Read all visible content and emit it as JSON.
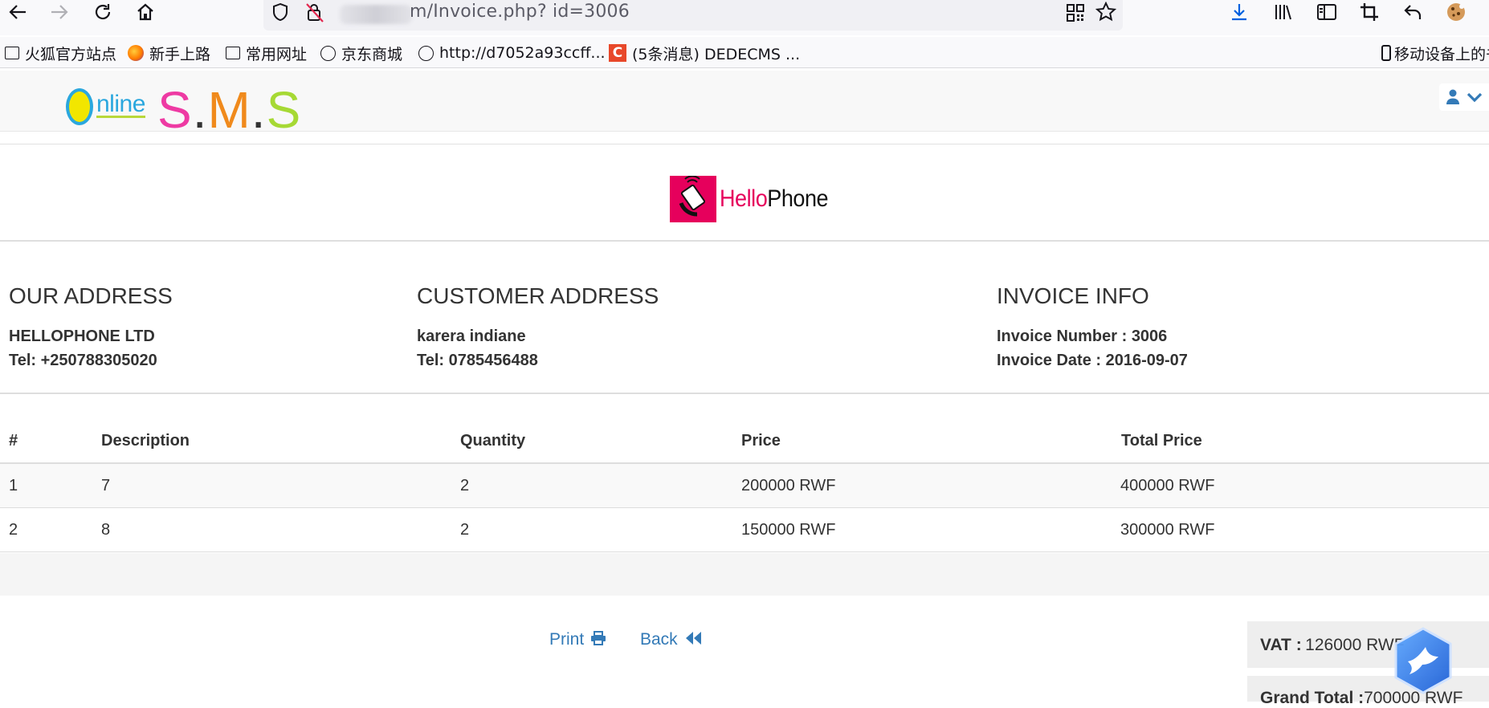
{
  "browser": {
    "url": "Invoice.php? id=3006",
    "url_prefix_visible": "m/Invoice.php? id=3006",
    "bookmarks": [
      {
        "label": "火狐官方站点",
        "icon": "folder-icon"
      },
      {
        "label": "新手上路",
        "icon": "firefox-icon"
      },
      {
        "label": "常用网址",
        "icon": "folder-icon"
      },
      {
        "label": "京东商城",
        "icon": "globe-icon"
      },
      {
        "label": "http://d7052a93ccff...",
        "icon": "globe-icon"
      },
      {
        "label": "(5条消息) DEDECMS ...",
        "icon": "csdn-icon"
      }
    ],
    "mobile_bookmarks": "移动设备上的书"
  },
  "app": {
    "logo_online_rest": "nline",
    "logo_sms": [
      "S",
      ".",
      "M",
      ".",
      "S"
    ]
  },
  "brand": {
    "hello": "Hello",
    "phone": "Phone"
  },
  "our_address": {
    "heading": "OUR ADDRESS",
    "name": "HELLOPHONE LTD",
    "tel": "Tel: +250788305020"
  },
  "customer_address": {
    "heading": "CUSTOMER ADDRESS",
    "name": "karera indiane",
    "tel": "Tel: 0785456488"
  },
  "invoice_info": {
    "heading": "INVOICE INFO",
    "number": "Invoice Number : 3006",
    "date": "Invoice Date : 2016-09-07"
  },
  "table": {
    "headers": [
      "#",
      "Description",
      "Quantity",
      "Price",
      "Total Price"
    ],
    "rows": [
      [
        "1",
        "7",
        "2",
        "200000 RWF",
        "400000 RWF"
      ],
      [
        "2",
        "8",
        "2",
        "150000 RWF",
        "300000 RWF"
      ]
    ]
  },
  "actions": {
    "print": "Print",
    "back": "Back"
  },
  "summary": {
    "vat_label": "VAT :",
    "vat_value": "126000 RWF",
    "grand_total_label": "Grand Total :",
    "grand_total_value": "700000 RWF"
  },
  "colors": {
    "link": "#337ab7",
    "brand_pink": "#e6005c",
    "logo_blue": "#2aa7de"
  }
}
